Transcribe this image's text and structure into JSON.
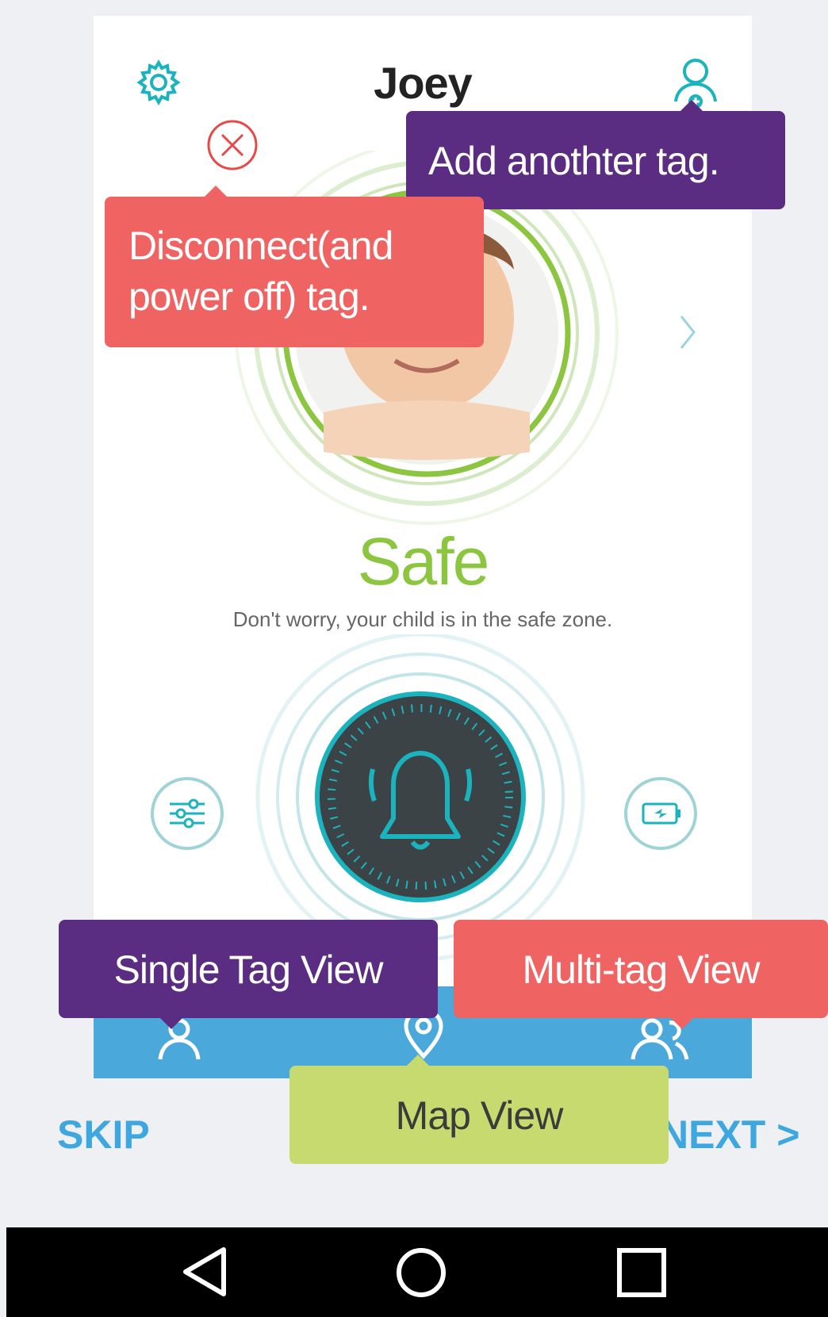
{
  "header": {
    "title": "Joey",
    "settings_icon": "gear-icon",
    "add_tag_icon": "add-person-icon",
    "disconnect_icon": "close-circle-icon"
  },
  "status": {
    "label": "Safe",
    "message": "Don't worry, your child is in the safe zone."
  },
  "controls": {
    "left_icon": "sliders-icon",
    "center_icon": "bell-icon",
    "right_icon": "battery-icon"
  },
  "bottom_nav": {
    "items": [
      {
        "icon": "person-icon"
      },
      {
        "icon": "map-pin-icon"
      },
      {
        "icon": "group-icon"
      }
    ]
  },
  "tooltips": {
    "add_tag": "Add anothter tag.",
    "disconnect_line1": "Disconnect(and",
    "disconnect_line2": "power off) tag.",
    "single_tag": "Single Tag View",
    "multi_tag": "Multi-tag View",
    "map_view": "Map View"
  },
  "onboarding": {
    "skip": "SKIP",
    "next": "NEXT >"
  },
  "colors": {
    "safe_green": "#8cc540",
    "nav_blue": "#4aa8db",
    "tooltip_purple": "#5a2d82",
    "tooltip_red": "#ef6463",
    "tooltip_green": "#c7da6f",
    "accent_teal": "#1bb3bd"
  }
}
